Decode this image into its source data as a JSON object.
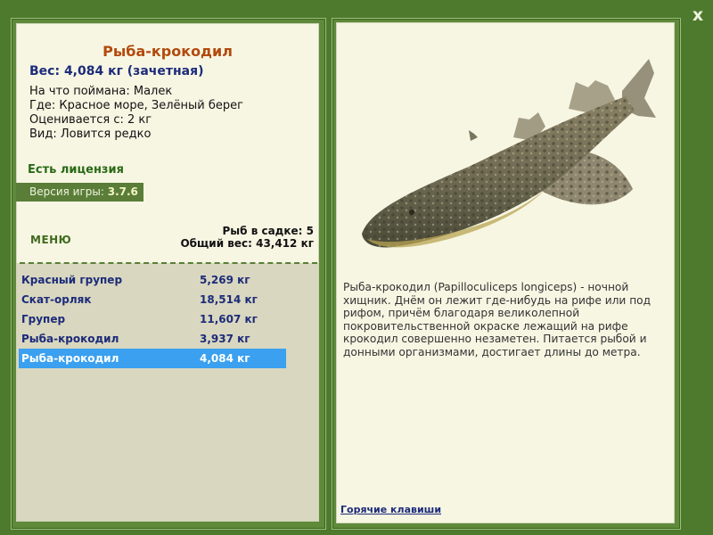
{
  "close_label": "x",
  "fish": {
    "title": "Рыба-крокодил",
    "weight": "Вес: 4,084 кг (зачетная)",
    "caught_on": "На что поймана: Малек",
    "location": "Где: Красное море, Зелёный берег",
    "rated_from": "Оценивается с: 2 кг",
    "rarity": "Вид: Ловится редко"
  },
  "license": "Есть лицензия",
  "version": {
    "label": "Версия игры: ",
    "value": "3.7.6"
  },
  "menu_label": "МЕНЮ",
  "keepnet": {
    "count": "Рыб в садке: 5",
    "total": "Общий вес: 43,412 кг"
  },
  "catch_list": [
    {
      "name": "Красный групер",
      "weight": "5,269 кг"
    },
    {
      "name": "Скат-орляк",
      "weight": "18,514 кг"
    },
    {
      "name": "Групер",
      "weight": "11,607 кг"
    },
    {
      "name": "Рыба-крокодил",
      "weight": "3,937 кг"
    },
    {
      "name": "Рыба-крокодил",
      "weight": "4,084 кг"
    }
  ],
  "selected_index": 4,
  "description": "Рыба-крокодил (Papilloculiceps longiceps) - ночной хищник. Днём он лежит где-нибудь на рифе или под рифом, причём благодаря великолепной покровительственной окраске лежащий на рифе крокодил совершенно незаметен. Питается рыбой и донными организмами, достигает длины до метра.",
  "hotkeys_label": "Горячие клавиши",
  "colors": {
    "background": "#4e7a2e",
    "panel": "#f7f6e3",
    "list_bg": "#d9d7bf",
    "selected": "#3aa0ef",
    "title": "#b34a0c",
    "text_blue": "#1c2b7a"
  }
}
